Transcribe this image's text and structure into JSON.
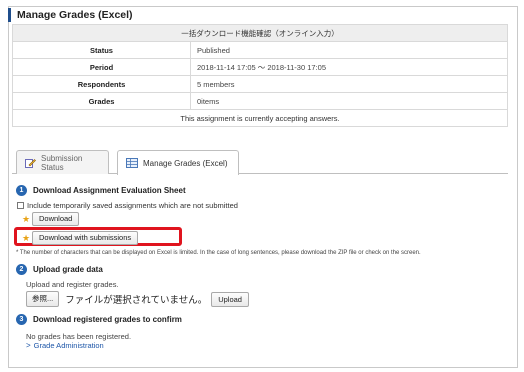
{
  "page": {
    "title": "Manage Grades (Excel)"
  },
  "info": {
    "caption": "一括ダウンロード機能確認（オンライン入力）",
    "rows": [
      {
        "label": "Status",
        "value": "Published"
      },
      {
        "label": "Period",
        "value": "2018-11-14 17:05 ～ 2018-11-30 17:05"
      },
      {
        "label": "Respondents",
        "value": "5 members"
      },
      {
        "label": "Grades",
        "value": "0items"
      }
    ],
    "footer": "This assignment is currently accepting answers."
  },
  "tabs": [
    {
      "label": "Submission Status",
      "icon": "pencil-icon",
      "active": false
    },
    {
      "label": "Manage Grades (Excel)",
      "icon": "spreadsheet-icon",
      "active": true
    }
  ],
  "step1": {
    "number": "1",
    "title": "Download Assignment Evaluation Sheet",
    "checkbox_label": "Include temporarily saved assignments which are not submitted",
    "checkbox_checked": false,
    "download_label": "Download",
    "download_with_label": "Download with submissions",
    "note": "* The number of characters that can be displayed on Excel is limited. In the case of long sentences, please download the ZIP file or check on the screen."
  },
  "step2": {
    "number": "2",
    "title": "Upload grade data",
    "desc": "Upload and register grades.",
    "browse_label": "参照...",
    "file_status": "ファイルが選択されていません。",
    "upload_label": "Upload"
  },
  "step3": {
    "number": "3",
    "title": "Download registered grades to confirm",
    "desc": "No grades has been registered.",
    "link_label": "Grade Administration"
  },
  "colors": {
    "accent": "#2766b0",
    "highlight": "#e0141e",
    "link": "#1d56a8",
    "star": "#e8a317"
  }
}
